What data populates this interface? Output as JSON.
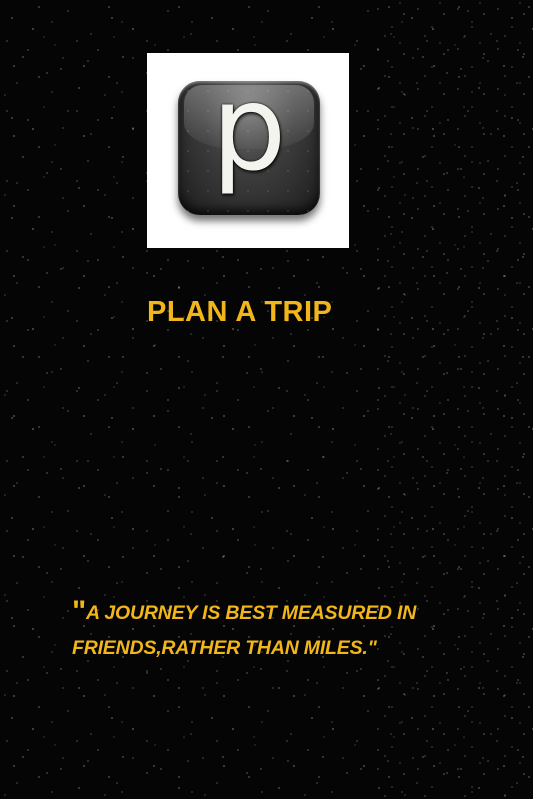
{
  "logo": {
    "letter": "p",
    "icon": "p-letter-app-icon"
  },
  "title": "PLAN A TRIP",
  "quote": {
    "open_mark": "\"",
    "line1": "A JOURNEY IS BEST MEASURED IN",
    "line2": "FRIENDS,RATHER THAN MILES.\""
  },
  "colors": {
    "accent": "#f2b61a",
    "background": "#000000",
    "logo_box": "#ffffff"
  }
}
